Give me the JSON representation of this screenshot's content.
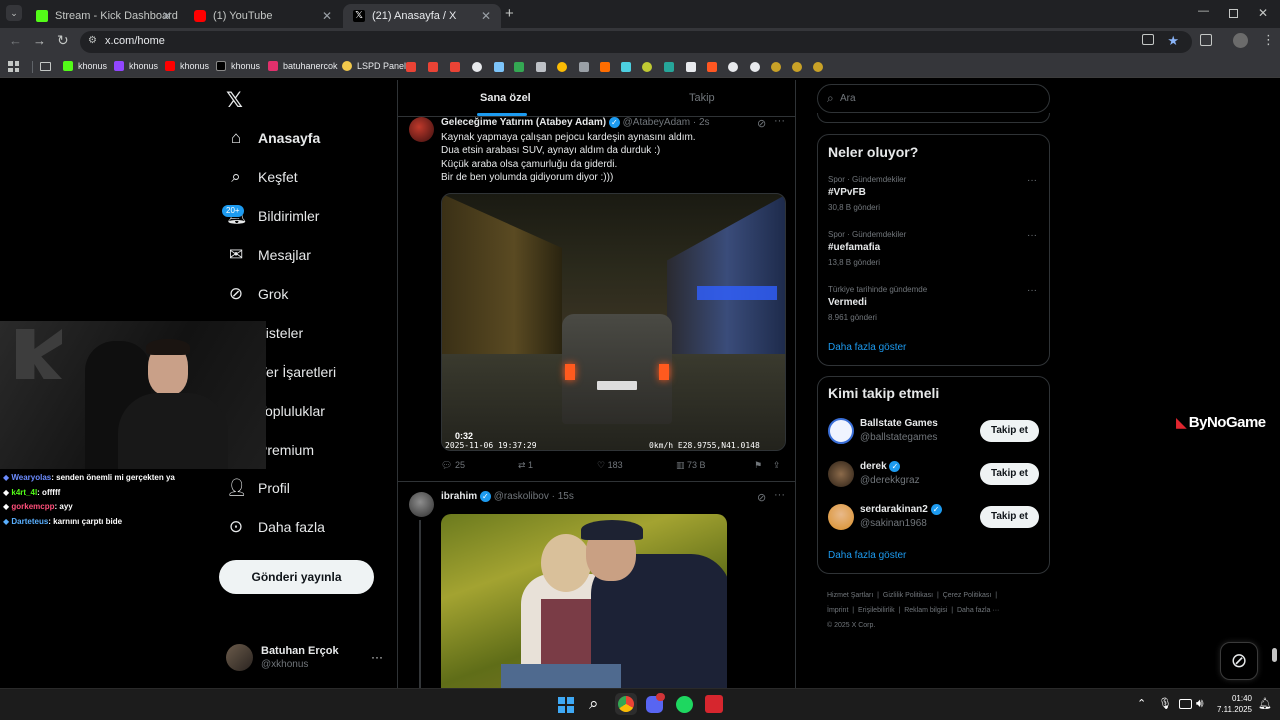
{
  "browser": {
    "tabs": [
      {
        "title": "Stream - Kick Dashboard",
        "color": "#53fc18"
      },
      {
        "title": "(1) YouTube",
        "color": "#ff0000"
      },
      {
        "title": "(21) Anasayfa / X",
        "color": "#ffffff"
      }
    ],
    "url": "x.com/home",
    "bookmarks": [
      "khonus",
      "khonus",
      "khonus",
      "khonus",
      "batuhanercok",
      "LSPD Panel"
    ]
  },
  "nav": {
    "items": [
      "Anasayfa",
      "Keşfet",
      "Bildirimler",
      "Mesajlar",
      "Grok",
      "Listeler",
      "Yer İşaretleri",
      "Topluluklar",
      "Premium",
      "Profil",
      "Daha fazla"
    ],
    "notif_badge": "20+",
    "post_button": "Gönderi yayınla",
    "user_name": "Batuhan Erçok",
    "user_handle": "@xkhonus"
  },
  "overlay": {
    "chat": [
      {
        "user": "Wearyolas",
        "msg": ": senden önemli mi gerçekten ya",
        "color": "#6c8cff"
      },
      {
        "user": "k4rt_4l",
        "msg": ": offfff",
        "color": "#53fc18"
      },
      {
        "user": "gorkemcpp",
        "msg": ": ayy",
        "color": "#ff4f7a"
      },
      {
        "user": "Darteteus",
        "msg": ": karnını çarptı bide",
        "color": "#5ab0ff"
      }
    ],
    "watermark": "ByNoGame"
  },
  "feed": {
    "tabs": [
      "Sana özel",
      "Takip"
    ],
    "post1": {
      "name": "Geleceğime Yatırım (Atabey Adam)",
      "handle": "@AtabeyAdam",
      "time": "· 2s",
      "lines": [
        "Kaynak yapmaya çalışan pejocu kardeşin aynasını aldım.",
        "Dua etsin arabası SUV, aynayı aldım da durduk :)",
        "Küçük araba olsa çamurluğu da giderdi.",
        "Bir de ben yolumda gidiyorum diyor :)))"
      ],
      "video_time": "0:32",
      "cam_stamp": "2025-11-06 19:37:29",
      "cam_speed": "0km/h E28.9755,N41.0148",
      "replies": "25",
      "reposts": "1",
      "likes": "183",
      "views": "73 B"
    },
    "post2": {
      "name": "ibrahim",
      "handle": "@raskolibov",
      "time": "· 15s"
    }
  },
  "sidebar": {
    "search_placeholder": "Ara",
    "trends_title": "Neler oluyor?",
    "trends": [
      {
        "cat": "Spor · Gündemdekiler",
        "name": "#VPvFB",
        "count": "30,8 B gönderi"
      },
      {
        "cat": "Spor · Gündemdekiler",
        "name": "#uefamafia",
        "count": "13,8 B gönderi"
      },
      {
        "cat": "Türkiye tarihinde gündemde",
        "name": "Vermedi",
        "count": "8.961 gönderi"
      }
    ],
    "show_more": "Daha fazla göster",
    "who_title": "Kimi takip etmeli",
    "who": [
      {
        "name": "Ballstate Games",
        "handle": "@ballstategames"
      },
      {
        "name": "derek",
        "handle": "@derekkgraz"
      },
      {
        "name": "serdarakinan2",
        "handle": "@sakinan1968"
      }
    ],
    "follow_label": "Takip et",
    "footer_row1": [
      "Hizmet Şartları",
      "Gizlilik Politikası",
      "Çerez Politikası"
    ],
    "footer_row2": [
      "İmprint",
      "Erişilebilirlik",
      "Reklam bilgisi",
      "Daha fazla ···"
    ],
    "copyright": "© 2025 X Corp."
  },
  "taskbar": {
    "time": "01:40",
    "date": "7.11.2025"
  }
}
